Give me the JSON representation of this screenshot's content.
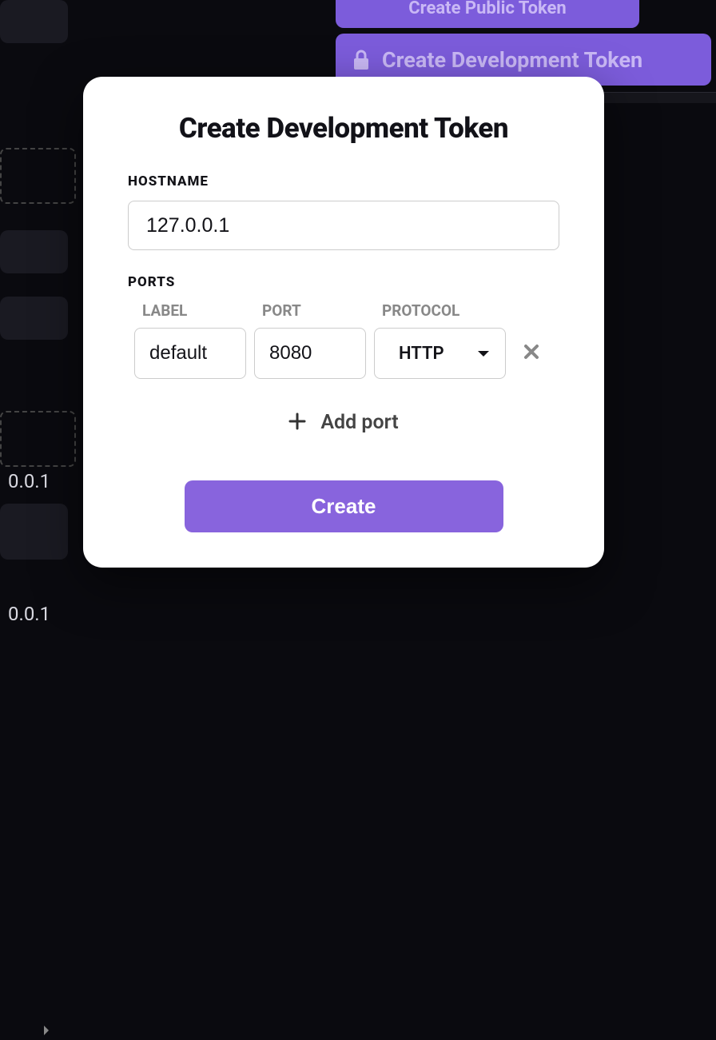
{
  "background": {
    "top_button_label": "Create Public Token",
    "dev_button_label": "Create Development Token",
    "ip_1": "0.0.1",
    "ip_2": "0.0.1"
  },
  "modal": {
    "title": "Create Development Token",
    "hostname": {
      "label": "HOSTNAME",
      "value": "127.0.0.1"
    },
    "ports": {
      "label": "PORTS",
      "columns": {
        "label": "LABEL",
        "port": "PORT",
        "protocol": "PROTOCOL"
      },
      "rows": [
        {
          "label": "default",
          "port": "8080",
          "protocol": "HTTP"
        }
      ]
    },
    "add_port_label": "Add port",
    "create_label": "Create"
  },
  "colors": {
    "accent": "#8864dd",
    "accent_dark": "#7c5cdb"
  }
}
